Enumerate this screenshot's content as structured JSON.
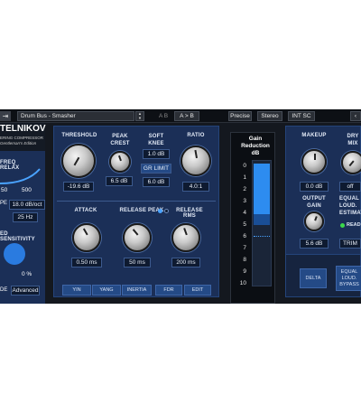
{
  "topbar": {
    "arrow": "⇥",
    "preset": "Drum Bus - Smasher",
    "ab_left": "A B",
    "ab_copy": "A > B",
    "precise": "Precise",
    "stereo": "Stereo",
    "sc": "INT SC",
    "corner": "‹"
  },
  "brand": {
    "title": "TELNIKOV",
    "sub1": "ERING COMPRESSOR",
    "sub2": "Gentleman's Edition"
  },
  "left": {
    "freq_relax": "FREQ RELAX",
    "f1": "50",
    "f2": "500",
    "pe": "PE",
    "db_oct": "18.0 dB/oct",
    "hz": "25 Hz",
    "ed_sens": "ED SENSITIVITY",
    "pct": "0 %",
    "de": "DE",
    "advanced": "Advanced"
  },
  "comp": {
    "threshold": "THRESHOLD",
    "threshold_val": "-19.6 dB",
    "peak": "PEAK\nCREST",
    "peak_val": "6.5 dB",
    "soft": "SOFT\nKNEE",
    "soft_val": "1.0 dB",
    "gr_limit": "GR LIMIT",
    "gr_val": "6.0 dB",
    "ratio": "RATIO",
    "ratio_val": "4.0:1",
    "attack": "ATTACK",
    "attack_val": "0.50 ms",
    "release_peak": "RELEASE PEAK",
    "release_rms": "RELEASE RMS",
    "rp_val": "50 ms",
    "rr_val": "200 ms",
    "btns": [
      "YIN",
      "YANG",
      "INERTIA",
      "FDR",
      "EDIT"
    ]
  },
  "meter": {
    "title": "Gain\nReduction\ndB",
    "ticks": [
      "0",
      "1",
      "2",
      "3",
      "4",
      "5",
      "6",
      "7",
      "8",
      "9",
      "10"
    ]
  },
  "right": {
    "makeup": "MAKEUP",
    "makeup_val": "0.0 dB",
    "dry": "DRY\nMIX",
    "dry_val": "off",
    "out": "OUTPUT\nGAIN",
    "out_val": "5.6 dB",
    "equal": "EQUAL\nLOUD.\nESTIMAT",
    "ready": "READ",
    "trim": "TRIM",
    "delta": "DELTA",
    "bypass": "EQUAL\nLOUD.\nBYPASS"
  }
}
